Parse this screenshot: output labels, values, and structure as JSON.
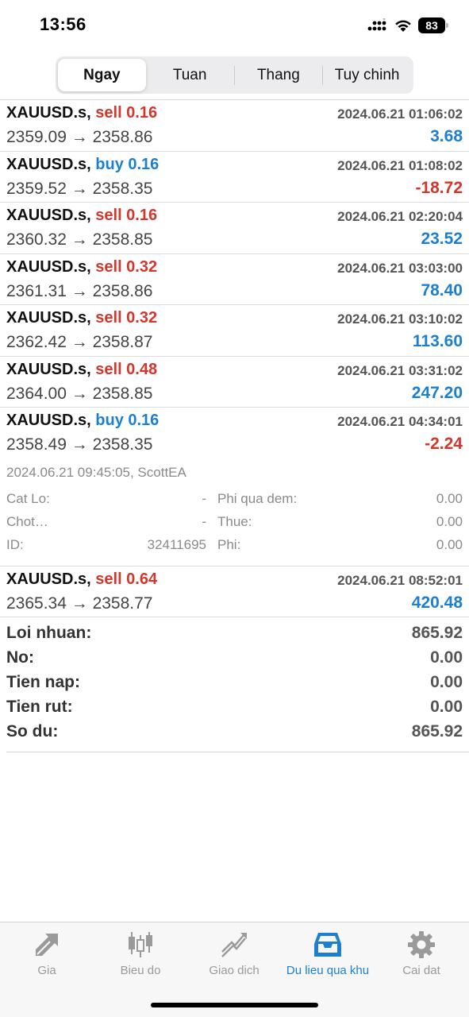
{
  "status": {
    "time": "13:56",
    "battery": "83"
  },
  "tabs": [
    {
      "label": "Ngay",
      "active": true
    },
    {
      "label": "Tuan",
      "active": false
    },
    {
      "label": "Thang",
      "active": false
    },
    {
      "label": "Tuy chinh",
      "active": false
    }
  ],
  "trades": [
    {
      "symbol": "XAUUSD.s,",
      "side": "sell 0.16",
      "time": "2024.06.21 01:06:02",
      "prices": "2359.09 → 2358.86",
      "profit": "3.68"
    },
    {
      "symbol": "XAUUSD.s,",
      "side": "buy 0.16",
      "time": "2024.06.21 01:08:02",
      "prices": "2359.52 → 2358.35",
      "profit": "-18.72"
    },
    {
      "symbol": "XAUUSD.s,",
      "side": "sell 0.16",
      "time": "2024.06.21 02:20:04",
      "prices": "2360.32 → 2358.85",
      "profit": "23.52"
    },
    {
      "symbol": "XAUUSD.s,",
      "side": "sell 0.32",
      "time": "2024.06.21 03:03:00",
      "prices": "2361.31 → 2358.86",
      "profit": "78.40"
    },
    {
      "symbol": "XAUUSD.s,",
      "side": "sell 0.32",
      "time": "2024.06.21 03:10:02",
      "prices": "2362.42 → 2358.87",
      "profit": "113.60"
    },
    {
      "symbol": "XAUUSD.s,",
      "side": "sell 0.48",
      "time": "2024.06.21 03:31:02",
      "prices": "2364.00 → 2358.85",
      "profit": "247.20"
    },
    {
      "symbol": "XAUUSD.s,",
      "side": "buy 0.16",
      "time": "2024.06.21 04:34:01",
      "prices": "2358.49 → 2358.35",
      "profit": "-2.24"
    },
    {
      "symbol": "XAUUSD.s,",
      "side": "sell 0.64",
      "time": "2024.06.21 08:52:01",
      "prices": "2365.34 → 2358.77",
      "profit": "420.48"
    }
  ],
  "details": {
    "header": "2024.06.21 09:45:05, ScottEA",
    "rows": [
      {
        "l": "Cat Lo:",
        "lv": "-",
        "r": "Phi qua dem:",
        "rv": "0.00"
      },
      {
        "l": "Chot…",
        "lv": "-",
        "r": "Thue:",
        "rv": "0.00"
      },
      {
        "l": "ID:",
        "lv": "32411695",
        "r": "Phi:",
        "rv": "0.00"
      }
    ]
  },
  "summary": [
    {
      "label": "Loi nhuan:",
      "value": "865.92"
    },
    {
      "label": "No:",
      "value": "0.00"
    },
    {
      "label": "Tien nap:",
      "value": "0.00"
    },
    {
      "label": "Tien rut:",
      "value": "0.00"
    },
    {
      "label": "So du:",
      "value": "865.92"
    }
  ],
  "tabbar": [
    {
      "label": "Gia",
      "icon": "quotes-arrows-icon"
    },
    {
      "label": "Bieu do",
      "icon": "candlestick-chart-icon"
    },
    {
      "label": "Giao dich",
      "icon": "trade-trend-icon"
    },
    {
      "label": "Du lieu qua khu",
      "icon": "history-tray-icon",
      "active": true
    },
    {
      "label": "Cai dat",
      "icon": "gear-icon"
    }
  ],
  "colors": {
    "sell": "#d2372b",
    "buy": "#1c7fd0",
    "accent": "#1c7fd0"
  }
}
